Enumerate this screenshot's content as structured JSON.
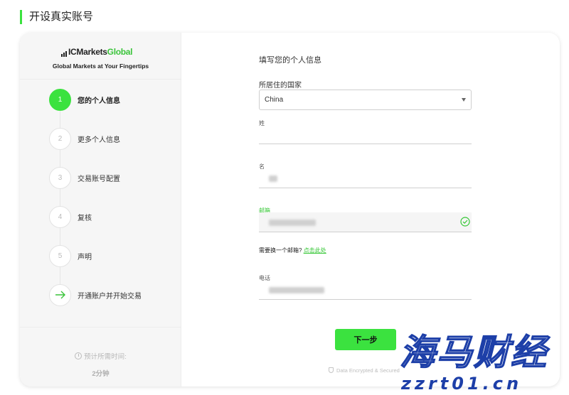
{
  "page": {
    "title": "开设真实账号"
  },
  "brand": {
    "logo_ic": "IC",
    "logo_markets": "Markets",
    "logo_global": "Global",
    "tagline": "Global Markets at Your Fingertips",
    "accent_color": "#3be23f"
  },
  "steps": [
    {
      "number": "1",
      "label": "您的个人信息",
      "active": true
    },
    {
      "number": "2",
      "label": "更多个人信息",
      "active": false
    },
    {
      "number": "3",
      "label": "交易账号配置",
      "active": false
    },
    {
      "number": "4",
      "label": "复核",
      "active": false
    },
    {
      "number": "5",
      "label": "声明",
      "active": false
    },
    {
      "icon": "arrow-right-icon",
      "label": "开通账户并开始交易",
      "active": false
    }
  ],
  "sidebar_footer": {
    "time_label": "预计所需时间:",
    "time_value": "2分钟"
  },
  "form": {
    "section_title": "填写您的个人信息",
    "country": {
      "label": "所居住的国家",
      "value": "China"
    },
    "last_name": {
      "label": "姓",
      "value": ""
    },
    "first_name": {
      "label": "名",
      "value": ""
    },
    "email": {
      "label": "邮箱",
      "value": "",
      "valid": true
    },
    "email_hint": {
      "text": "需要换一个邮箱?",
      "link": "点击此处"
    },
    "phone": {
      "label": "电话",
      "value": ""
    },
    "next_button": "下一步",
    "secure_text": "Data Encrypted & Secured"
  },
  "watermark": {
    "cn": "海马财经",
    "url": "zzrt01.cn"
  }
}
